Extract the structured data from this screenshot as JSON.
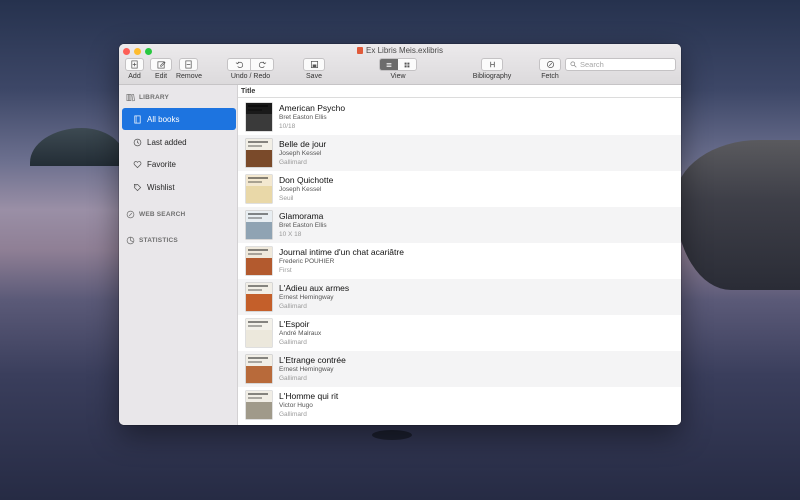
{
  "window": {
    "title": "Ex Libris Meis.exlibris"
  },
  "toolbar": {
    "add_label": "Add",
    "edit_label": "Edit",
    "remove_label": "Remove",
    "undo_redo_label": "Undo / Redo",
    "save_label": "Save",
    "view_label": "View",
    "bibliography_label": "Bibliography",
    "fetch_label": "Fetch",
    "search_placeholder": "Search",
    "search_value": ""
  },
  "sidebar": {
    "library_header": "LIBRARY",
    "items": [
      {
        "label": "All books",
        "icon": "book-icon",
        "selected": true
      },
      {
        "label": "Last added",
        "icon": "clock-icon",
        "selected": false
      },
      {
        "label": "Favorite",
        "icon": "heart-icon",
        "selected": false
      },
      {
        "label": "Wishlist",
        "icon": "tag-icon",
        "selected": false
      }
    ],
    "web_search_header": "WEB SEARCH",
    "statistics_header": "STATISTICS"
  },
  "table": {
    "column_title": "Title",
    "books": [
      {
        "title": "American Psycho",
        "author": "Bret Easton Ellis",
        "publisher": "10/18",
        "cover_top": "#1a1a1a",
        "cover_bottom": "#3a3a3a"
      },
      {
        "title": "Belle de jour",
        "author": "Joseph Kessel",
        "publisher": "Gallimard",
        "cover_top": "#f2efe6",
        "cover_bottom": "#7a4a2a"
      },
      {
        "title": "Don Quichotte",
        "author": "Joseph Kessel",
        "publisher": "Seuil",
        "cover_top": "#f3e8d0",
        "cover_bottom": "#e9d8a8"
      },
      {
        "title": "Glamorama",
        "author": "Bret Easton Ellis",
        "publisher": "10 X 18",
        "cover_top": "#e8eef2",
        "cover_bottom": "#8fa3b3"
      },
      {
        "title": "Journal intime d'un chat acariâtre",
        "author": "Frederic POUHIER",
        "publisher": "First",
        "cover_top": "#efe9dc",
        "cover_bottom": "#b35a2e"
      },
      {
        "title": "L'Adieu aux armes",
        "author": "Ernest Hemingway",
        "publisher": "Gallimard",
        "cover_top": "#f1eee6",
        "cover_bottom": "#c45f2a"
      },
      {
        "title": "L'Espoir",
        "author": "André Malraux",
        "publisher": "Gallimard",
        "cover_top": "#f3f1ea",
        "cover_bottom": "#ece8dc"
      },
      {
        "title": "L'Etrange contrée",
        "author": "Ernest Hemingway",
        "publisher": "Gallimard",
        "cover_top": "#f1eee6",
        "cover_bottom": "#b86a3a"
      },
      {
        "title": "L'Homme qui rit",
        "author": "Victor Hugo",
        "publisher": "Gallimard",
        "cover_top": "#f1eee6",
        "cover_bottom": "#a09a8a"
      }
    ]
  },
  "colors": {
    "selection": "#1d74e0",
    "close": "#fd5f57",
    "minimize": "#febc2e",
    "zoom": "#28c840"
  }
}
